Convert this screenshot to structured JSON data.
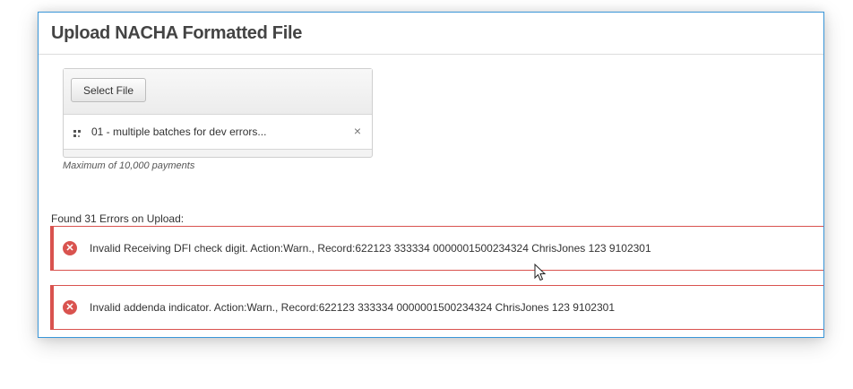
{
  "page": {
    "title": "Upload NACHA Formatted File"
  },
  "upload": {
    "select_label": "Select File",
    "file_name": "01 - multiple batches for dev errors...",
    "remove_glyph": "×",
    "max_note": "Maximum of 10,000 payments"
  },
  "errors": {
    "heading": "Found 31 Errors on Upload:",
    "items": [
      "Invalid Receiving DFI check digit. Action:Warn., Record:622123 333334 0000001500234324 ChrisJones 123 9102301",
      "Invalid addenda indicator. Action:Warn., Record:622123 333334 0000001500234324 ChrisJones 123 9102301"
    ],
    "icon_glyph": "✕"
  },
  "icons": {
    "file": "file-icon",
    "error": "error-circle-icon",
    "close": "close-icon",
    "cursor": "mouse-pointer-icon"
  },
  "colors": {
    "accent_border": "#3a96d8",
    "error_red": "#d9534f",
    "title_text": "#444444"
  }
}
